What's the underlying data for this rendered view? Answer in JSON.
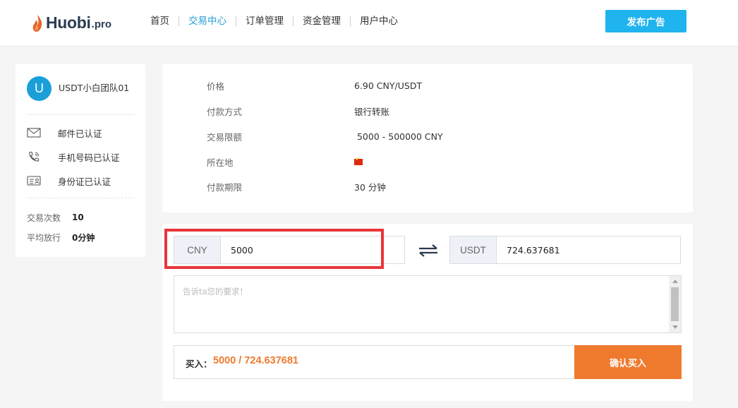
{
  "header": {
    "logo_main": "Huobi",
    "logo_sub": ".pro",
    "nav": [
      {
        "label": "首页"
      },
      {
        "label": "交易中心"
      },
      {
        "label": "订单管理"
      },
      {
        "label": "资金管理"
      },
      {
        "label": "用户中心"
      }
    ],
    "active_nav": "交易中心",
    "publish_button": "发布广告"
  },
  "user": {
    "avatar_letter": "U",
    "name": "USDT小白团队01",
    "verifications": [
      {
        "icon": "mail-icon",
        "label": "邮件已认证"
      },
      {
        "icon": "phone-icon",
        "label": "手机号码已认证"
      },
      {
        "icon": "id-card-icon",
        "label": "身份证已认证"
      }
    ],
    "stats": [
      {
        "label": "交易次数",
        "value": "10"
      },
      {
        "label": "平均放行",
        "value": "0分钟"
      }
    ]
  },
  "info": {
    "rows": [
      {
        "label": "价格",
        "value": "6.90 CNY/USDT"
      },
      {
        "label": "付款方式",
        "value": "银行转账"
      },
      {
        "label": "交易限额",
        "value": " 5000 - 500000 CNY"
      },
      {
        "label": "所在地",
        "value": "",
        "icon": "china-flag-icon"
      },
      {
        "label": "付款期限",
        "value": "30 分钟"
      }
    ]
  },
  "order": {
    "cny_tag": "CNY",
    "cny_value": "5000",
    "usdt_tag": "USDT",
    "usdt_value": "724.637681",
    "message_placeholder": "告诉ta您的要求！",
    "buy_label": "买入：",
    "buy_amount": "5000 / 724.637681",
    "confirm_button": "确认买入"
  },
  "colors": {
    "brand_blue": "#20b4ee",
    "nav_active": "#24a0d7",
    "orange": "#ef7a2e",
    "highlight_red": "#e8363a"
  }
}
